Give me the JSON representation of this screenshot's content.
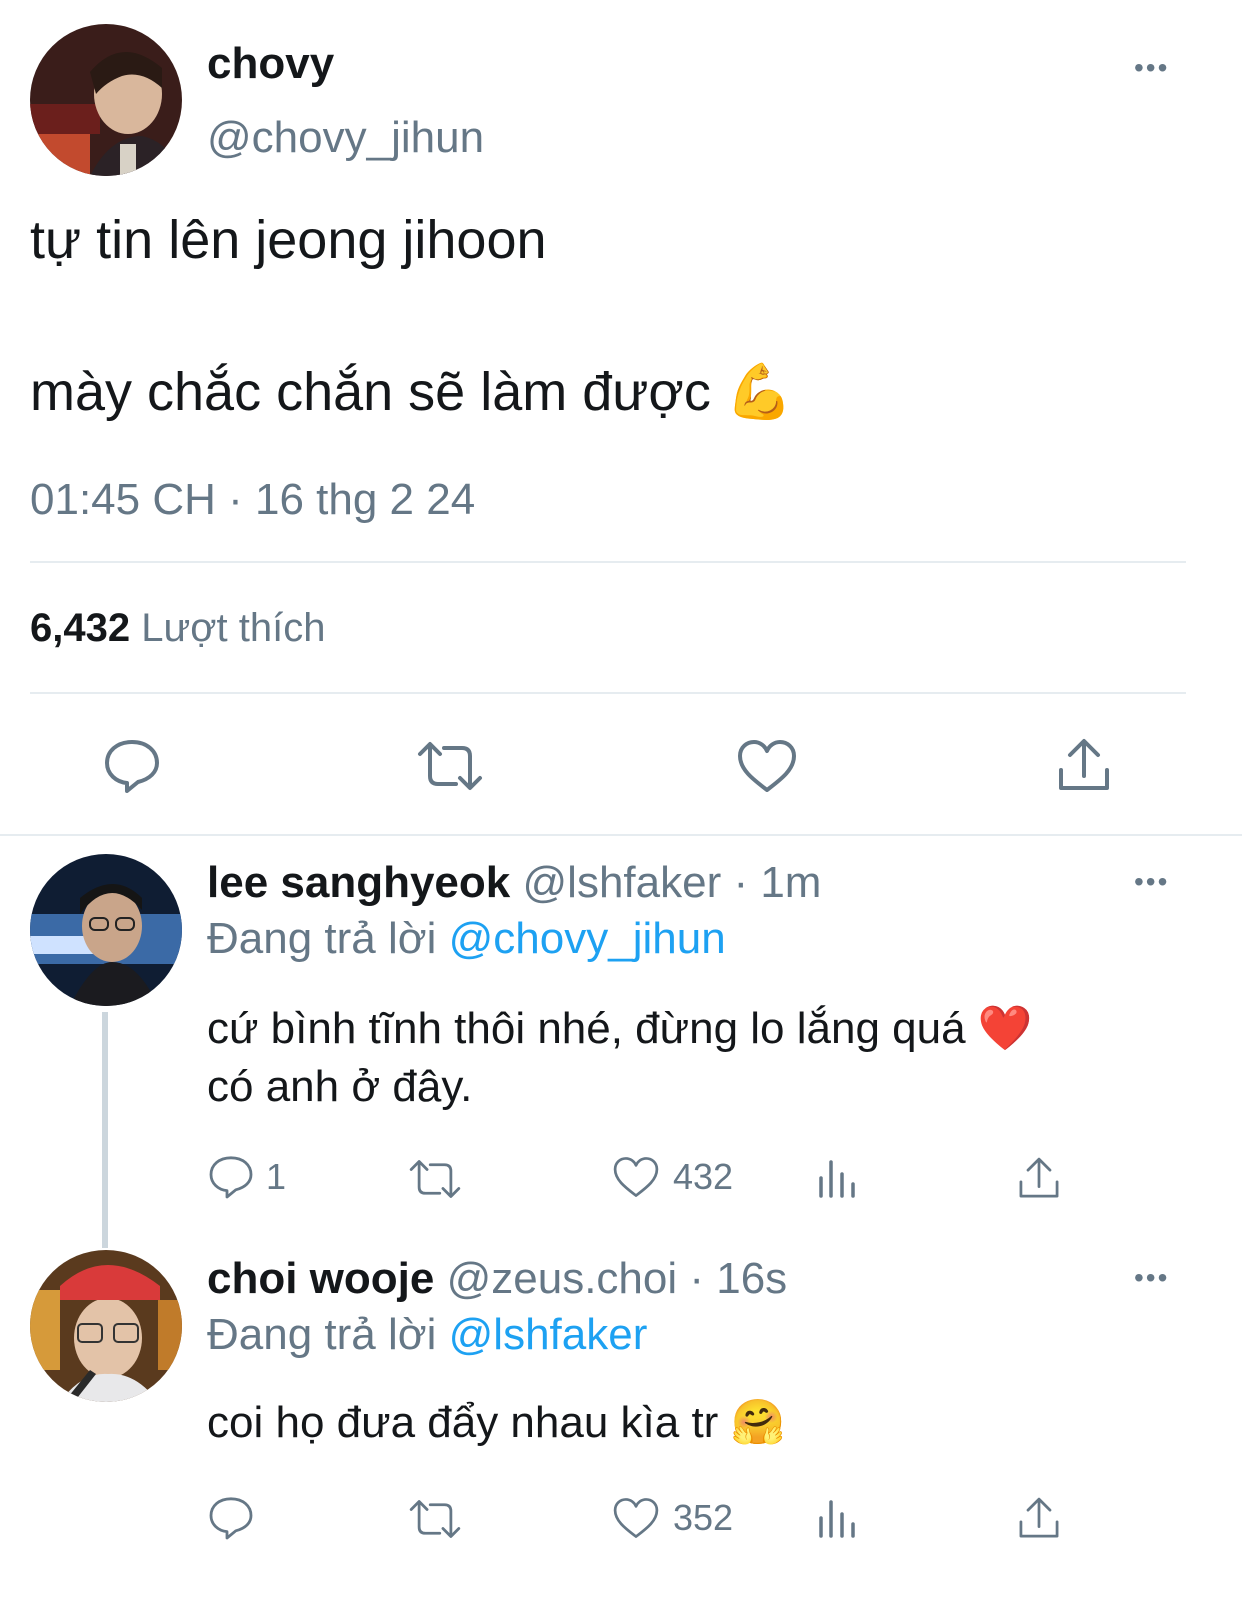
{
  "main_tweet": {
    "author_name": "chovy",
    "author_handle": "@chovy_jihun",
    "line1": "tự tin lên jeong jihoon",
    "line2": "mày chắc chắn sẽ làm được",
    "line2_emoji": "💪",
    "timestamp": "01:45 CH · 16 thg 2 24",
    "likes_count": "6,432",
    "likes_label": "Lượt thích",
    "more": "•••"
  },
  "replies": [
    {
      "author_name": "lee sanghyeok",
      "handle_time": "@lshfaker · 1m",
      "replying_prefix": "Đang trả lời",
      "replying_to": "@chovy_jihun",
      "text_line1": "cứ bình tĩnh thôi nhé, đừng lo lắng quá",
      "text_emoji": "❤️",
      "text_line2": "có anh ở đây.",
      "reply_count": "1",
      "like_count": "432",
      "more": "•••"
    },
    {
      "author_name": "choi wooje",
      "handle_time": "@zeus.choi · 16s",
      "replying_prefix": "Đang trả lời",
      "replying_to": "@lshfaker",
      "text_line1": "coi họ đưa đẩy nhau kìa tr",
      "text_emoji": "🤗",
      "like_count": "352",
      "more": "•••"
    }
  ],
  "icons": [
    "reply-icon",
    "retweet-icon",
    "like-icon",
    "share-icon",
    "analytics-icon",
    "more-icon"
  ],
  "colors": {
    "text": "#14171a",
    "secondary": "#657786",
    "link": "#1da1f2",
    "divider": "#e6ecf0"
  }
}
